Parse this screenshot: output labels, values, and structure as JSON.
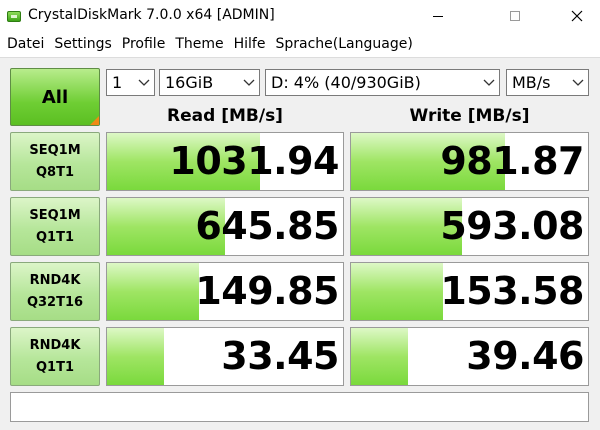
{
  "window": {
    "title": "CrystalDiskMark 7.0.0 x64 [ADMIN]",
    "controls": [
      "minimize-icon",
      "maximize-icon",
      "close-icon"
    ]
  },
  "menu": [
    "Datei",
    "Settings",
    "Profile",
    "Theme",
    "Hilfe",
    "Sprache(Language)"
  ],
  "toolbar": {
    "all_label": "All",
    "count": "1",
    "size": "16GiB",
    "drive": "D: 4% (40/930GiB)",
    "unit": "MB/s"
  },
  "headers": {
    "read": "Read [MB/s]",
    "write": "Write [MB/s]"
  },
  "tests": [
    {
      "line1": "SEQ1M",
      "line2": "Q8T1",
      "read": "1031.94",
      "write": "981.87",
      "read_fill": 0.65,
      "write_fill": 0.65
    },
    {
      "line1": "SEQ1M",
      "line2": "Q1T1",
      "read": "645.85",
      "write": "593.08",
      "read_fill": 0.5,
      "write_fill": 0.47
    },
    {
      "line1": "RND4K",
      "line2": "Q32T16",
      "read": "149.85",
      "write": "153.58",
      "read_fill": 0.39,
      "write_fill": 0.39
    },
    {
      "line1": "RND4K",
      "line2": "Q1T1",
      "read": "33.45",
      "write": "39.46",
      "read_fill": 0.24,
      "write_fill": 0.24
    }
  ],
  "status_text": "",
  "colors": {
    "bar_green": "#7ad93c",
    "button_green": "#6fce34",
    "corner_orange": "#f08a14",
    "close_red": "#e81123"
  }
}
